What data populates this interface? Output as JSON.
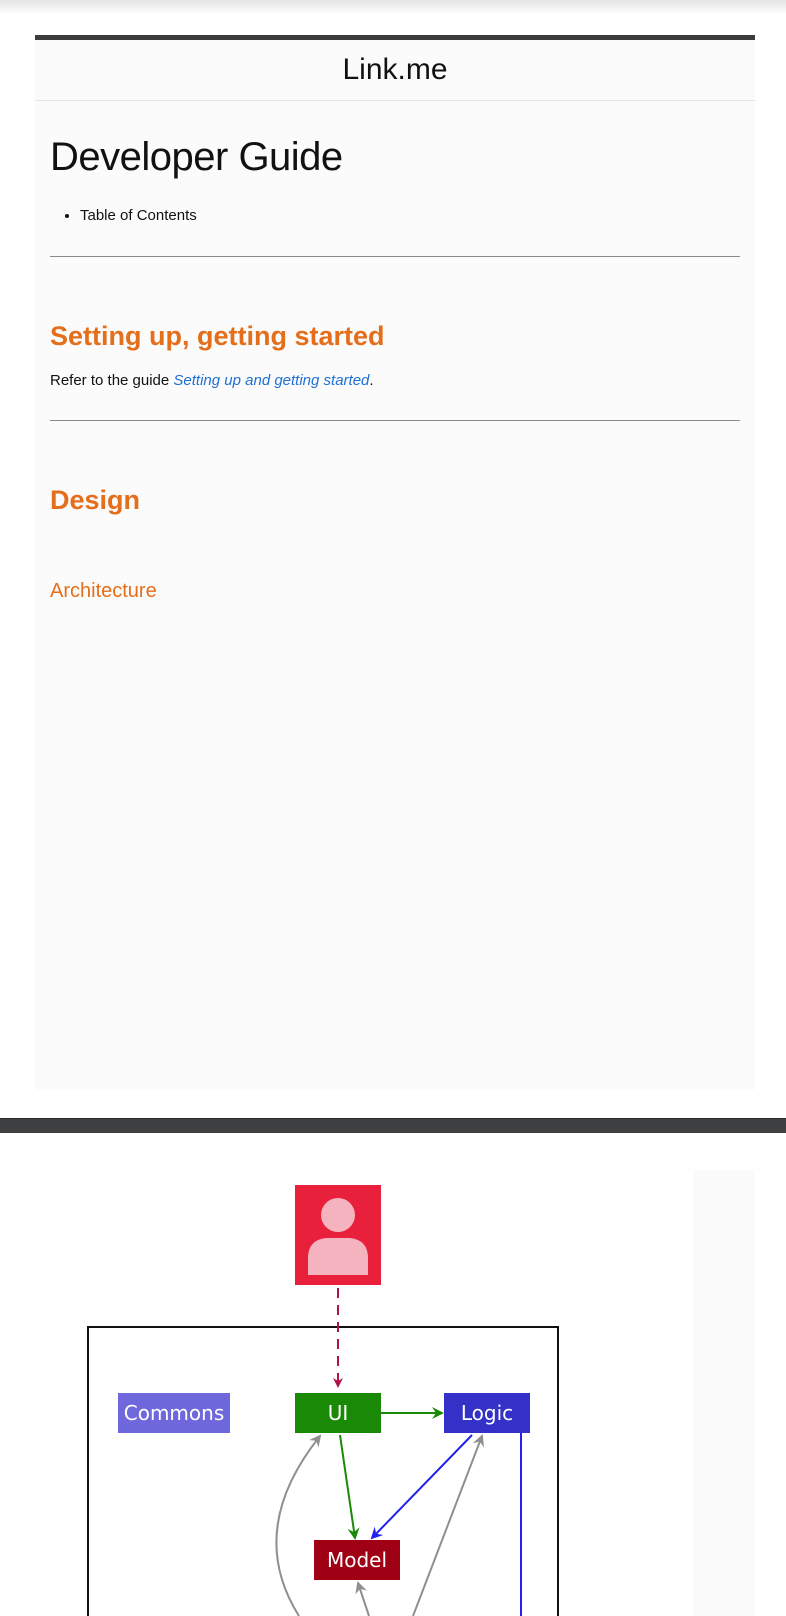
{
  "site": {
    "title": "Link.me"
  },
  "page": {
    "title": "Developer Guide",
    "toc": [
      "Table of Contents"
    ]
  },
  "sections": {
    "setup": {
      "heading": "Setting up, getting started",
      "text_before": "Refer to the guide ",
      "link_text": "Setting up and getting started",
      "text_after": "."
    },
    "design": {
      "heading": "Design",
      "architecture": {
        "heading": "Architecture"
      }
    }
  },
  "diagram": {
    "nodes": {
      "commons": "Commons",
      "ui": "UI",
      "logic": "Logic",
      "model": "Model"
    },
    "colors": {
      "user": "#e8203c",
      "user_figure": "#f5b3bf",
      "commons": "#6e68dc",
      "ui": "#1a8a06",
      "logic": "#3431c8",
      "model": "#a00014",
      "user_arrow": "#b0134a",
      "gray_arrow": "#8f8f8f"
    },
    "icons": [
      "user-icon"
    ]
  }
}
